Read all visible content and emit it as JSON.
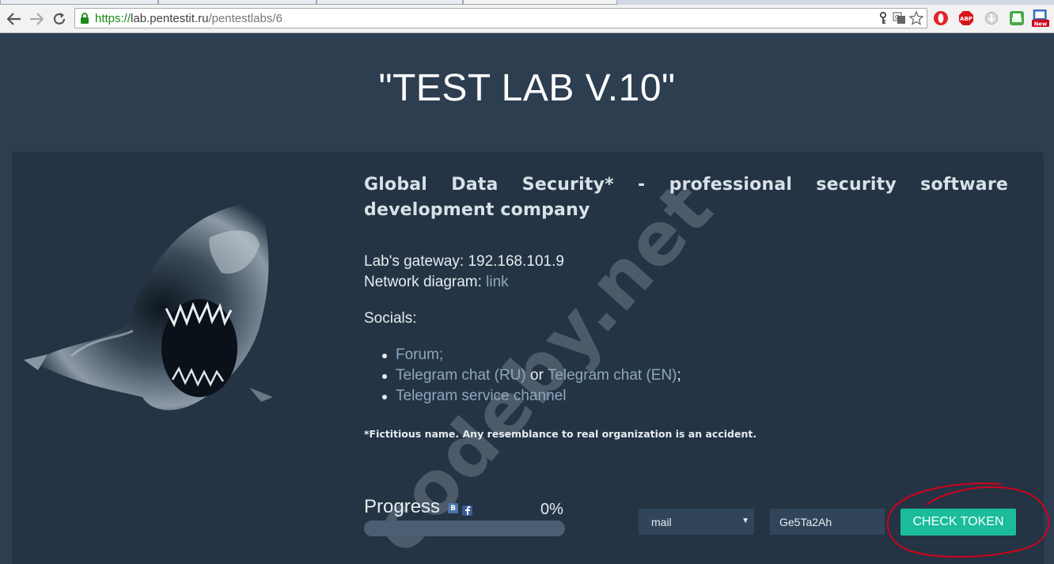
{
  "browser": {
    "url_protocol": "https://",
    "url_host": "lab.pentestit.ru",
    "url_path": "/pentestlabs/6",
    "extensions": [
      "key-icon",
      "translate-icon",
      "star-icon",
      "opera-icon",
      "adblock-icon",
      "download-icon",
      "print-icon",
      "new-extension-icon"
    ],
    "adblock_label": "ABP",
    "new_badge_label": "New"
  },
  "page": {
    "title": "\"TEST LAB V.10\"",
    "company": "Global Data Security* - professional security software development company",
    "gateway_label": "Lab's gateway: ",
    "gateway_value": "192.168.101.9",
    "diagram_label": "Network diagram: ",
    "diagram_link": "link",
    "socials_label": "Socials:",
    "socials": {
      "forum": "Forum;",
      "tg_ru": "Telegram chat (RU)",
      "or": " or ",
      "tg_en": "Telegram chat (EN)",
      "semicolon": ";",
      "channel": "Telegram service channel"
    },
    "note": "*Fictitious name. Any resemblance to real organization is an accident."
  },
  "progress": {
    "label": "Progress",
    "percent_text": "0%",
    "value": 0,
    "share_vk": "B"
  },
  "token_form": {
    "select_value": "mail",
    "token_value": "Ge5Ta2Ah",
    "button_label": "CHECK TOKEN"
  },
  "watermark": "codeby.net",
  "colors": {
    "background": "#2c3e50",
    "panel": "#243444",
    "accent": "#1abc9c",
    "link": "#8fa7bd",
    "annotation": "#d0021b"
  }
}
